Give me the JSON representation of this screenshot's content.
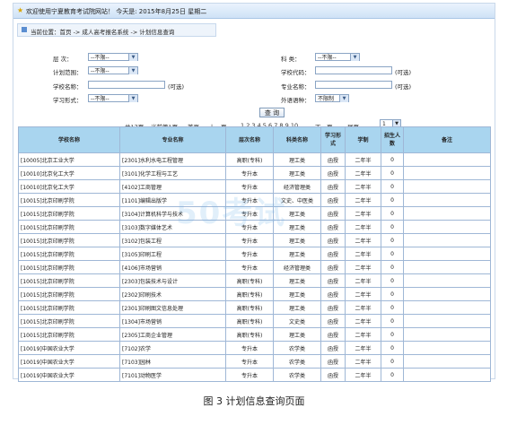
{
  "topbar": {
    "welcome": "欢迎使用宁夏教育考试院网站！  今天是: 2015年8月25日  星期二"
  },
  "breadcrumb": {
    "text": "当前位置：首页 -> 成人高考报名系统 -> 计划信息查询"
  },
  "form": {
    "level_label": "层      次：",
    "level_value": "--不限--",
    "plan_scope_label": "计划范围：",
    "plan_scope_value": "--不限--",
    "school_name_label": "学校名称：",
    "any_hint_1": "(可选)",
    "study_form_label": "学习形式：",
    "study_form_value": "--不限--",
    "category_label": "科      类：",
    "category_value": "--不限--",
    "school_code_label": "学校代码：",
    "any_hint_2": "(可选)",
    "major_name_label": "专业名称：",
    "any_hint_3": "(可选)",
    "foreign_lang_label": "外语语种：",
    "foreign_lang_value": "不限制",
    "query_button": "查 询"
  },
  "pager": {
    "total": "共17页",
    "current": "当前第1页",
    "first": "首页",
    "prev": "上一页",
    "pages": "1 2 3 4 5 6 7 8 9 10",
    "next": "下一页",
    "last": "尾页",
    "select_value": "1"
  },
  "table": {
    "headers": [
      "学校名称",
      "专业名称",
      "层次名称",
      "科类名称",
      "学习形式",
      "学制",
      "招生人数",
      "备注"
    ],
    "rows": [
      [
        "[10005]北京工业大学",
        "[2301]水利水电工程管理",
        "高职(专科)",
        "理工类",
        "函授",
        "二年半",
        "0",
        ""
      ],
      [
        "[10010]北京化工大学",
        "[3101]化学工程与工艺",
        "专升本",
        "理工类",
        "函授",
        "二年半",
        "0",
        ""
      ],
      [
        "[10010]北京化工大学",
        "[4102]工商管理",
        "专升本",
        "经济管理类",
        "函授",
        "二年半",
        "0",
        ""
      ],
      [
        "[10015]北京印刷学院",
        "[1101]编辑出版学",
        "专升本",
        "文史、中医类",
        "函授",
        "二年半",
        "0",
        ""
      ],
      [
        "[10015]北京印刷学院",
        "[3104]计算机科学与技术",
        "专升本",
        "理工类",
        "函授",
        "二年半",
        "0",
        ""
      ],
      [
        "[10015]北京印刷学院",
        "[3103]数字媒体艺术",
        "专升本",
        "理工类",
        "函授",
        "二年半",
        "0",
        ""
      ],
      [
        "[10015]北京印刷学院",
        "[3102]包装工程",
        "专升本",
        "理工类",
        "函授",
        "二年半",
        "0",
        ""
      ],
      [
        "[10015]北京印刷学院",
        "[3105]印刷工程",
        "专升本",
        "理工类",
        "函授",
        "二年半",
        "0",
        ""
      ],
      [
        "[10015]北京印刷学院",
        "[4106]市场营销",
        "专升本",
        "经济管理类",
        "函授",
        "二年半",
        "0",
        ""
      ],
      [
        "[10015]北京印刷学院",
        "[2303]包装技术与设计",
        "高职(专科)",
        "理工类",
        "函授",
        "二年半",
        "0",
        ""
      ],
      [
        "[10015]北京印刷学院",
        "[2302]印刷技术",
        "高职(专科)",
        "理工类",
        "函授",
        "二年半",
        "0",
        ""
      ],
      [
        "[10015]北京印刷学院",
        "[2301]印刷图文信息处理",
        "高职(专科)",
        "理工类",
        "函授",
        "二年半",
        "0",
        ""
      ],
      [
        "[10015]北京印刷学院",
        "[1304]市场营销",
        "高职(专科)",
        "文史类",
        "函授",
        "二年半",
        "0",
        ""
      ],
      [
        "[10015]北京印刷学院",
        "[2305]工商企业管理",
        "高职(专科)",
        "理工类",
        "函授",
        "二年半",
        "0",
        ""
      ],
      [
        "[10019]中国农业大学",
        "[7102]农学",
        "专升本",
        "农学类",
        "函授",
        "二年半",
        "0",
        ""
      ],
      [
        "[10019]中国农业大学",
        "[7103]园林",
        "专升本",
        "农学类",
        "函授",
        "二年半",
        "0",
        ""
      ],
      [
        "[10019]中国农业大学",
        "[7101]动物医学",
        "专升本",
        "农学类",
        "函授",
        "二年半",
        "0",
        ""
      ]
    ]
  },
  "caption": "图 3  计划信息查询页面",
  "watermark": "50考试"
}
